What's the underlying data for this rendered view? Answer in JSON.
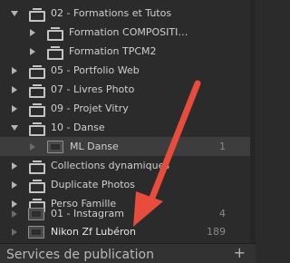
{
  "collections": [
    {
      "label": "02 - Formations et Tutos",
      "count": ""
    },
    {
      "label": "Formation COMPOSITI…",
      "count": ""
    },
    {
      "label": "Formation TPCM2",
      "count": ""
    },
    {
      "label": "05 - Portfolio Web",
      "count": ""
    },
    {
      "label": "07 - Livres Photo",
      "count": ""
    },
    {
      "label": "09 - Projet Vitry",
      "count": ""
    },
    {
      "label": "10 - Danse",
      "count": ""
    },
    {
      "label": "ML Danse",
      "count": "1"
    },
    {
      "label": "Collections dynamiques",
      "count": ""
    },
    {
      "label": "Duplicate Photos",
      "count": ""
    },
    {
      "label": "Perso Famille",
      "count": ""
    },
    {
      "label": "01 - Instagram",
      "count": "4"
    },
    {
      "label": "Nikon Zf Lubéron",
      "count": "189"
    }
  ],
  "footer": {
    "title": "Services de publication",
    "add_label": "+"
  },
  "colors": {
    "arrow": "#e74c3c",
    "background": "#2b2b2b",
    "selected_row": "#3d3d3d"
  }
}
